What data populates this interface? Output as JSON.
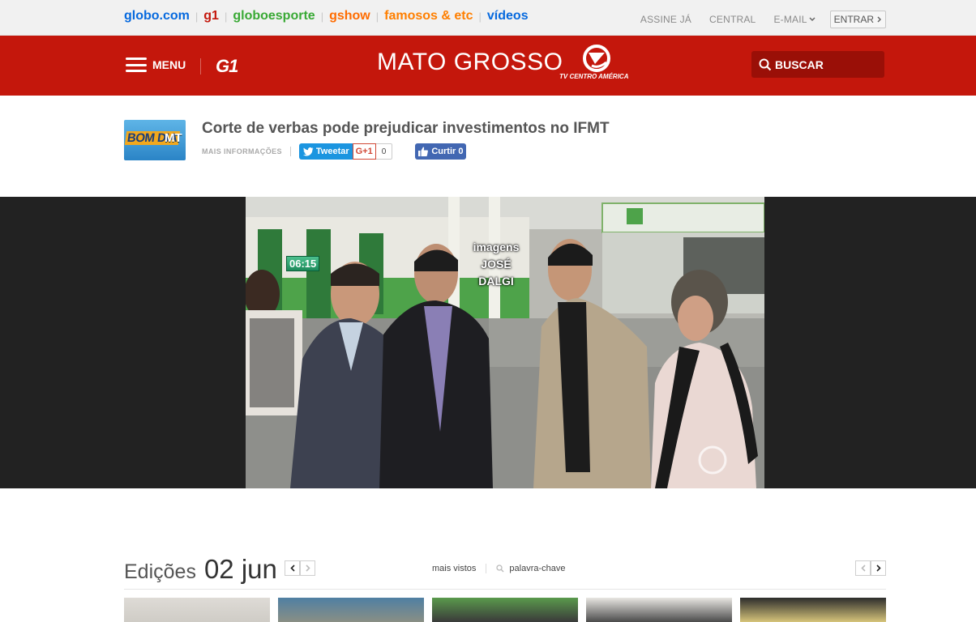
{
  "globo_bar": {
    "brands": [
      {
        "label": "globo.com",
        "color": "#0669de"
      },
      {
        "label": "g1",
        "color": "#c4170c"
      },
      {
        "label": "globoesporte",
        "color": "#39a935"
      },
      {
        "label": "gshow",
        "color": "#ff6c00"
      },
      {
        "label": "famosos & etc",
        "color": "#ff7f00"
      },
      {
        "label": "vídeos",
        "color": "#0669de"
      }
    ],
    "links": {
      "assine": "ASSINE JÁ",
      "central": "CENTRAL",
      "email": "E-MAIL",
      "entrar": "ENTRAR"
    }
  },
  "header": {
    "menu_label": "MENU",
    "site_logo": "G1",
    "region_title": "MATO GROSSO",
    "broadcaster": "TV CENTRO AMÉRICA",
    "search_label": "BUSCAR",
    "color": "#c4170c"
  },
  "article": {
    "program_thumb": {
      "line1": "BOM DIA",
      "line2": "MT"
    },
    "title": "Corte de verbas pode prejudicar investimentos no IFMT",
    "more_info": "MAIS INFORMAÇÕES",
    "share": {
      "tweet": "Tweetar",
      "gplus": "G+1",
      "gplus_count": "0",
      "fb_like": "Curtir 0"
    }
  },
  "video": {
    "timestamp": "06:15",
    "credit_line1": "imagens",
    "credit_line2": "JOSÉ DALGI"
  },
  "editions": {
    "label": "Edições",
    "date": "02 jun",
    "tab_most_viewed": "mais vistos",
    "keyword_placeholder": "palavra-chave"
  }
}
